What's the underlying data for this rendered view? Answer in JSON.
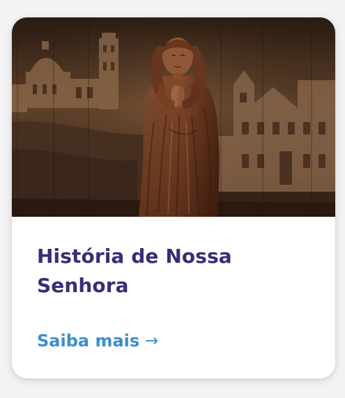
{
  "card": {
    "image_alt": "Imagem de Nossa Senhora",
    "title": "História de Nossa Senhora",
    "link_label": "Saiba mais",
    "link_arrow": "→"
  },
  "colors": {
    "title": "#3d2a76",
    "link": "#3b8fc7",
    "card_background": "#ffffff",
    "page_background": "#f3f3f4"
  },
  "icons": {
    "link_arrow": "arrow-right-icon"
  }
}
